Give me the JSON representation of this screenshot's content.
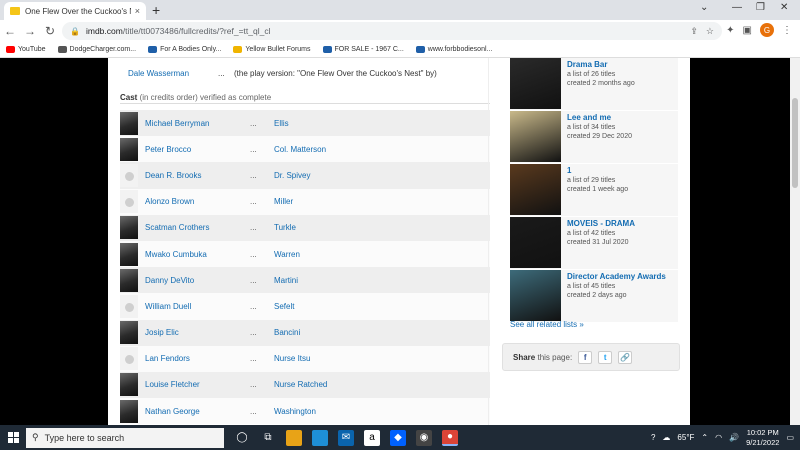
{
  "browser": {
    "tab_title": "One Flew Over the Cuckoo's Nest",
    "tab_close": "×",
    "new_tab": "+",
    "url_host": "imdb.com",
    "url_path": "/title/tt0073486/fullcredits/?ref_=tt_ql_cl",
    "profile_initial": "G"
  },
  "bookmarks": [
    {
      "label": "YouTube",
      "color": "#ff0000"
    },
    {
      "label": "DodgeCharger.com...",
      "color": "#555555"
    },
    {
      "label": "For A Bodies Only...",
      "color": "#1f5fa8"
    },
    {
      "label": "Yellow Bullet Forums",
      "color": "#f0b400"
    },
    {
      "label": "FOR SALE - 1967 C...",
      "color": "#1f5fa8"
    },
    {
      "label": "www.forbbodiesonl...",
      "color": "#1f5fa8"
    }
  ],
  "writer": {
    "name": "Dale Wasserman",
    "dots": "...",
    "credit": "(the play version: \"One Flew Over the Cuckoo's Nest\" by)"
  },
  "cast_section": {
    "title": "Cast",
    "note": " (in credits order) verified as complete"
  },
  "cast": [
    {
      "actor": "Michael Berryman",
      "character": "Ellis",
      "photo": true
    },
    {
      "actor": "Peter Brocco",
      "character": "Col. Matterson",
      "photo": true
    },
    {
      "actor": "Dean R. Brooks",
      "character": "Dr. Spivey",
      "photo": false
    },
    {
      "actor": "Alonzo Brown",
      "character": "Miller",
      "photo": false
    },
    {
      "actor": "Scatman Crothers",
      "character": "Turkle",
      "photo": true
    },
    {
      "actor": "Mwako Cumbuka",
      "character": "Warren",
      "photo": true
    },
    {
      "actor": "Danny DeVito",
      "character": "Martini",
      "photo": true
    },
    {
      "actor": "William Duell",
      "character": "Sefelt",
      "photo": false
    },
    {
      "actor": "Josip Elic",
      "character": "Bancini",
      "photo": true
    },
    {
      "actor": "Lan Fendors",
      "character": "Nurse Itsu",
      "photo": false
    },
    {
      "actor": "Louise Fletcher",
      "character": "Nurse Ratched",
      "photo": true
    },
    {
      "actor": "Nathan George",
      "character": "Washington",
      "photo": true
    }
  ],
  "cast_dots": "...",
  "related_lists": [
    {
      "name": "Drama Bar",
      "count": "a list of 26 titles",
      "created": "created 2 months ago",
      "thumb": "#2a2a2a"
    },
    {
      "name": "Lee and me",
      "count": "a list of 34 titles",
      "created": "created 29 Dec 2020",
      "thumb": "#c9b98a"
    },
    {
      "name": "1",
      "count": "a list of 29 titles",
      "created": "created 1 week ago",
      "thumb": "#5a3a1e"
    },
    {
      "name": "MOVEIS - DRAMA",
      "count": "a list of 42 titles",
      "created": "created 31 Jul 2020",
      "thumb": "#1a1a1a"
    },
    {
      "name": "Director Academy Awards",
      "count": "a list of 45 titles",
      "created": "created 2 days ago",
      "thumb": "#3d6b7a"
    }
  ],
  "see_all": "See all related lists »",
  "share": {
    "label": "Share",
    "suffix": "this page:",
    "facebook": "f",
    "twitter": "t",
    "link": "🔗"
  },
  "taskbar": {
    "search_placeholder": "Type here to search",
    "weather": "65°F",
    "time": "10:02 PM",
    "date": "9/21/2022"
  }
}
